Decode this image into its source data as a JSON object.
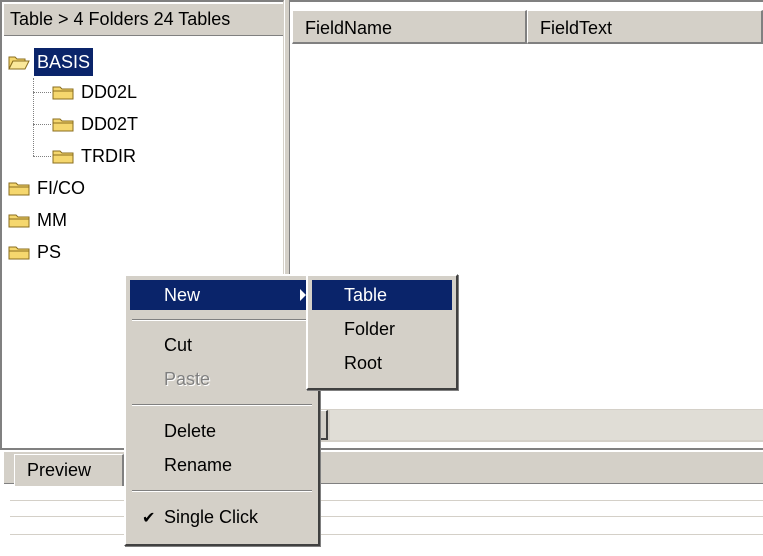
{
  "tree_panel": {
    "header": "Table > 4 Folders 24 Tables",
    "items": [
      {
        "label": "BASIS",
        "selected": true
      },
      {
        "label": "DD02L"
      },
      {
        "label": "DD02T"
      },
      {
        "label": "TRDIR"
      },
      {
        "label": "FI/CO"
      },
      {
        "label": "MM"
      },
      {
        "label": "PS"
      }
    ]
  },
  "list_panel": {
    "columns": [
      "FieldName",
      "FieldText"
    ]
  },
  "preview": {
    "tab": "Preview"
  },
  "context_menu": {
    "items": {
      "new": "New",
      "cut": "Cut",
      "paste": "Paste",
      "delete": "Delete",
      "rename": "Rename",
      "single_click": "Single Click"
    },
    "paste_enabled": false,
    "single_click_checked": true
  },
  "submenu": {
    "items": [
      "Table",
      "Folder",
      "Root"
    ],
    "highlighted": "Table"
  },
  "colors": {
    "selection": "#0a246a",
    "window_face": "#d4d0c8",
    "folder": "#f5d76e"
  }
}
